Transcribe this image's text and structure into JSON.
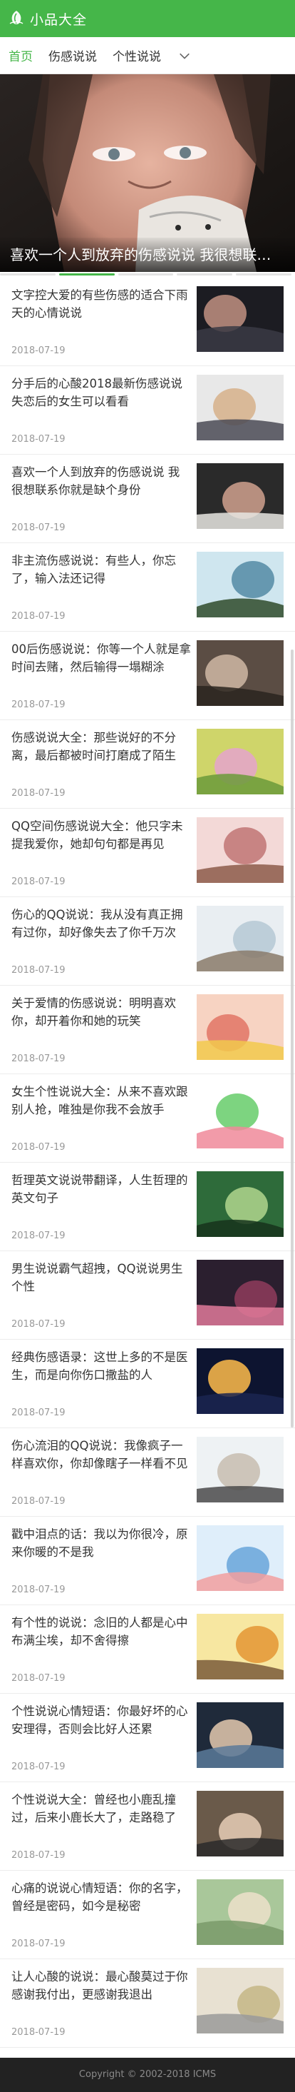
{
  "header": {
    "logo_text": "小品大全",
    "brand_color": "#45b649"
  },
  "nav": {
    "items": [
      "首页",
      "伤感说说",
      "个性说说"
    ],
    "active_index": 0,
    "more_icon": "chevron-down-icon"
  },
  "banner": {
    "caption": "喜欢一个人到放弃的伤感说说 我很想联系你就是缺个身份",
    "slide_count": 5,
    "active_slide": 1
  },
  "articles": [
    {
      "title": "文字控大爱的有些伤感的适合下雨天的心情说说",
      "date": "2018-07-19"
    },
    {
      "title": "分手后的心酸2018最新伤感说说 失恋后的女生可以看看",
      "date": "2018-07-19"
    },
    {
      "title": "喜欢一个人到放弃的伤感说说 我很想联系你就是缺个身份",
      "date": "2018-07-19"
    },
    {
      "title": "非主流伤感说说：有些人，你忘了，输入法还记得",
      "date": "2018-07-19"
    },
    {
      "title": "00后伤感说说：你等一个人就是拿时间去赌，然后输得一塌糊涂",
      "date": "2018-07-19"
    },
    {
      "title": "伤感说说大全：那些说好的不分离，最后都被时间打磨成了陌生",
      "date": "2018-07-19"
    },
    {
      "title": "QQ空间伤感说说大全：他只字未提我爱你，她却句句都是再见",
      "date": "2018-07-19"
    },
    {
      "title": "伤心的QQ说说：我从没有真正拥有过你，却好像失去了你千万次",
      "date": "2018-07-19"
    },
    {
      "title": "关于爱情的伤感说说：明明喜欢你，却开着你和她的玩笑",
      "date": "2018-07-19"
    },
    {
      "title": "女生个性说说大全：从来不喜欢跟别人抢，唯独是你我不会放手",
      "date": "2018-07-19"
    },
    {
      "title": "哲理英文说说带翻译，人生哲理的英文句子",
      "date": "2018-07-19"
    },
    {
      "title": "男生说说霸气超拽，QQ说说男生个性",
      "date": "2018-07-19"
    },
    {
      "title": "经典伤感语录：这世上多的不是医生，而是向你伤口撒盐的人",
      "date": "2018-07-19"
    },
    {
      "title": "伤心流泪的QQ说说：我像疯子一样喜欢你，你却像瞎子一样看不见",
      "date": "2018-07-19"
    },
    {
      "title": "戳中泪点的话：我以为你很冷，原来你暖的不是我",
      "date": "2018-07-19"
    },
    {
      "title": "有个性的说说：念旧的人都是心中布满尘埃，却不舍得擦",
      "date": "2018-07-19"
    },
    {
      "title": "个性说说心情短语：你最好坏的心安理得，否则会比好人还累",
      "date": "2018-07-19"
    },
    {
      "title": "个性说说大全：曾经也小鹿乱撞过，后来小鹿长大了，走路稳了",
      "date": "2018-07-19"
    },
    {
      "title": "心痛的说说心情短语：你的名字，曾经是密码，如今是秘密",
      "date": "2018-07-19"
    },
    {
      "title": "让人心酸的说说：最心酸莫过于你感谢我付出，更感谢我退出",
      "date": "2018-07-19"
    }
  ],
  "footer": {
    "copyright": "Copyright © 2002-2018 ICMS"
  }
}
